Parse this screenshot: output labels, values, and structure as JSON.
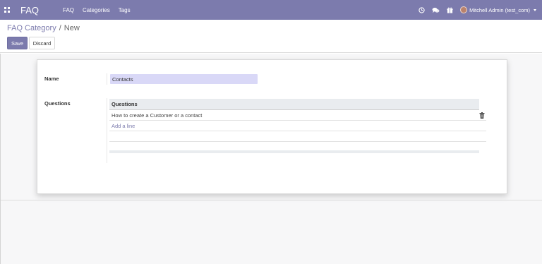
{
  "navbar": {
    "app_title": "FAQ",
    "menu": [
      "FAQ",
      "Categories",
      "Tags"
    ],
    "user_name": "Mitchell Admin (test_com)"
  },
  "breadcrumb": {
    "parent": "FAQ Category",
    "separator": "/",
    "current": "New"
  },
  "buttons": {
    "save": "Save",
    "discard": "Discard"
  },
  "form": {
    "name_label": "Name",
    "name_value": "Contacts",
    "questions_label": "Questions",
    "questions_column": "Questions",
    "rows": [
      "How to create a Customer or a contact"
    ],
    "add_line": "Add a line"
  },
  "icons": [
    "apps-grid-icon",
    "clock-icon",
    "chat-icon",
    "gift-icon",
    "trash-icon",
    "chevron-down-icon"
  ],
  "colors": {
    "brand": "#7c7bad",
    "input_highlight": "#d9d8f7"
  }
}
